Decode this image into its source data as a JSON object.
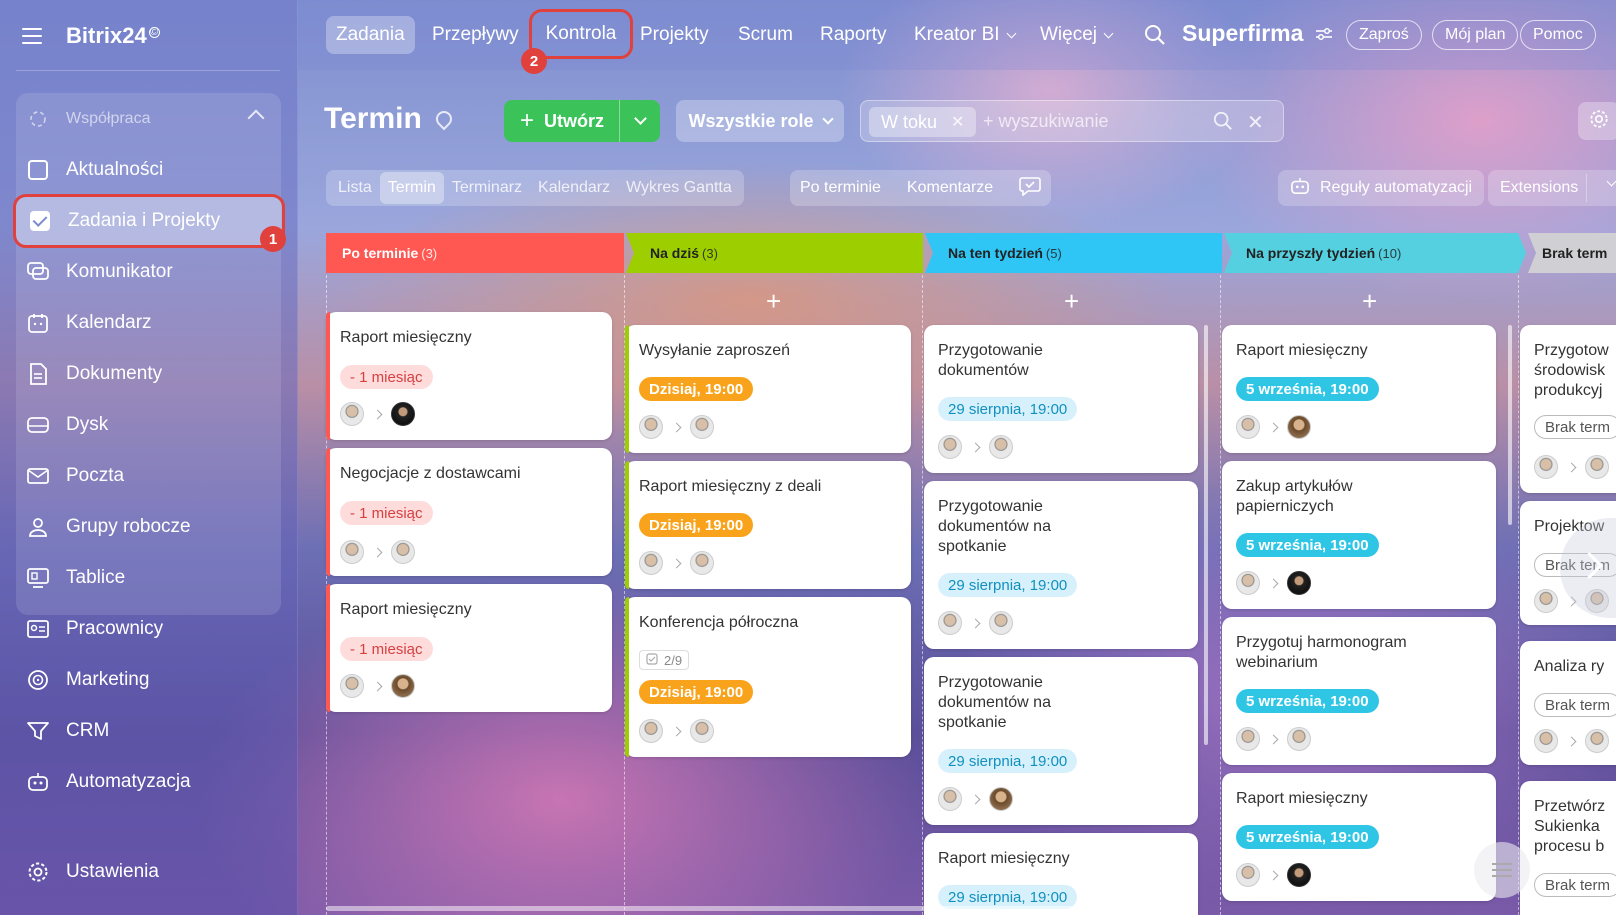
{
  "sidebar": {
    "logo": "Bitrix24",
    "logo_mark": "©",
    "group_title": "Współpraca",
    "items": [
      {
        "label": "Aktualności",
        "icon": "news-icon"
      },
      {
        "label": "Zadania i Projekty",
        "icon": "tasks-check-icon"
      },
      {
        "label": "Komunikator",
        "icon": "chat-icon"
      },
      {
        "label": "Kalendarz",
        "icon": "calendar-icon"
      },
      {
        "label": "Dokumenty",
        "icon": "document-icon"
      },
      {
        "label": "Dysk",
        "icon": "drive-icon"
      },
      {
        "label": "Poczta",
        "icon": "mail-icon"
      },
      {
        "label": "Grupy robocze",
        "icon": "groups-icon"
      },
      {
        "label": "Tablice",
        "icon": "boards-icon"
      },
      {
        "label": "Pracownicy",
        "icon": "employees-icon"
      },
      {
        "label": "Marketing",
        "icon": "marketing-icon"
      },
      {
        "label": "CRM",
        "icon": "crm-icon"
      },
      {
        "label": "Automatyzacja",
        "icon": "automation-icon"
      },
      {
        "label": "Ustawienia",
        "icon": "settings-icon"
      }
    ],
    "step_badge": "1"
  },
  "topnav": {
    "items": [
      "Zadania",
      "Przepływy",
      "Kontrola",
      "Projekty",
      "Scrum",
      "Raporty",
      "Kreator BI",
      "Więcej"
    ],
    "step_badge": "2",
    "company": "Superfirma",
    "invite": "Zaproś",
    "plan": "Mój plan",
    "help": "Pomoc"
  },
  "header": {
    "title": "Termin",
    "create": "Utwórz",
    "roles": "Wszystkie role",
    "filter_chip": "W toku",
    "search_placeholder": "+ wyszukiwanie"
  },
  "view_tabs": [
    "Lista",
    "Termin",
    "Terminarz",
    "Kalendarz",
    "Wykres Gantta"
  ],
  "filter_tabs": [
    "Po terminie",
    "Komentarze"
  ],
  "automation": "Reguły automatyzacji",
  "extensions": "Extensions",
  "columns": [
    {
      "title": "Po terminie",
      "count": "(3)",
      "color": "#ff5752"
    },
    {
      "title": "Na dziś",
      "count": "(3)",
      "color": "#9dcf00"
    },
    {
      "title": "Na ten tydzień",
      "count": "(5)",
      "color": "#2fc6f6"
    },
    {
      "title": "Na przyszły tydzień",
      "count": "(10)",
      "color": "#55d0e0"
    },
    {
      "title": "Brak term",
      "count": "",
      "color": "#c8c8c8"
    }
  ],
  "cards": {
    "c1": [
      {
        "title": "Raport miesięczny",
        "deadline": "- 1 miesiąc"
      },
      {
        "title": "Negocjacje z dostawcami",
        "deadline": "- 1 miesiąc"
      },
      {
        "title": "Raport miesięczny",
        "deadline": "- 1 miesiąc"
      }
    ],
    "c2": [
      {
        "title": "Wysyłanie zaproszeń",
        "deadline": "Dzisiaj, 19:00"
      },
      {
        "title": "Raport miesięczny z deali",
        "deadline": "Dzisiaj, 19:00"
      },
      {
        "title": "Konferencja półroczna",
        "deadline": "Dzisiaj, 19:00",
        "checklist": "2/9"
      }
    ],
    "c3": [
      {
        "title": "Przygotowanie dokumentów",
        "deadline": "29 sierpnia, 19:00"
      },
      {
        "title": "Przygotowanie dokumentów na spotkanie",
        "deadline": "29 sierpnia, 19:00"
      },
      {
        "title": "Przygotowanie dokumentów na spotkanie",
        "deadline": "29 sierpnia, 19:00"
      },
      {
        "title": "Raport miesięczny",
        "deadline": "29 sierpnia, 19:00"
      }
    ],
    "c4": [
      {
        "title": "Raport miesięczny",
        "deadline": "5 września, 19:00"
      },
      {
        "title": "Zakup artykułów papierniczych",
        "deadline": "5 września, 19:00"
      },
      {
        "title": "Przygotuj harmonogram webinarium",
        "deadline": "5 września, 19:00"
      },
      {
        "title": "Raport miesięczny",
        "deadline": "5 września, 19:00"
      }
    ],
    "c5": [
      {
        "title": "Przygotow środowisk produkcyj",
        "deadline": "Brak term"
      },
      {
        "title": "Projektow",
        "deadline": "Brak term"
      },
      {
        "title": "Analiza ry",
        "deadline": "Brak term"
      },
      {
        "title": "Przetwórz Sukienka procesu b",
        "deadline": "Brak term"
      }
    ]
  }
}
